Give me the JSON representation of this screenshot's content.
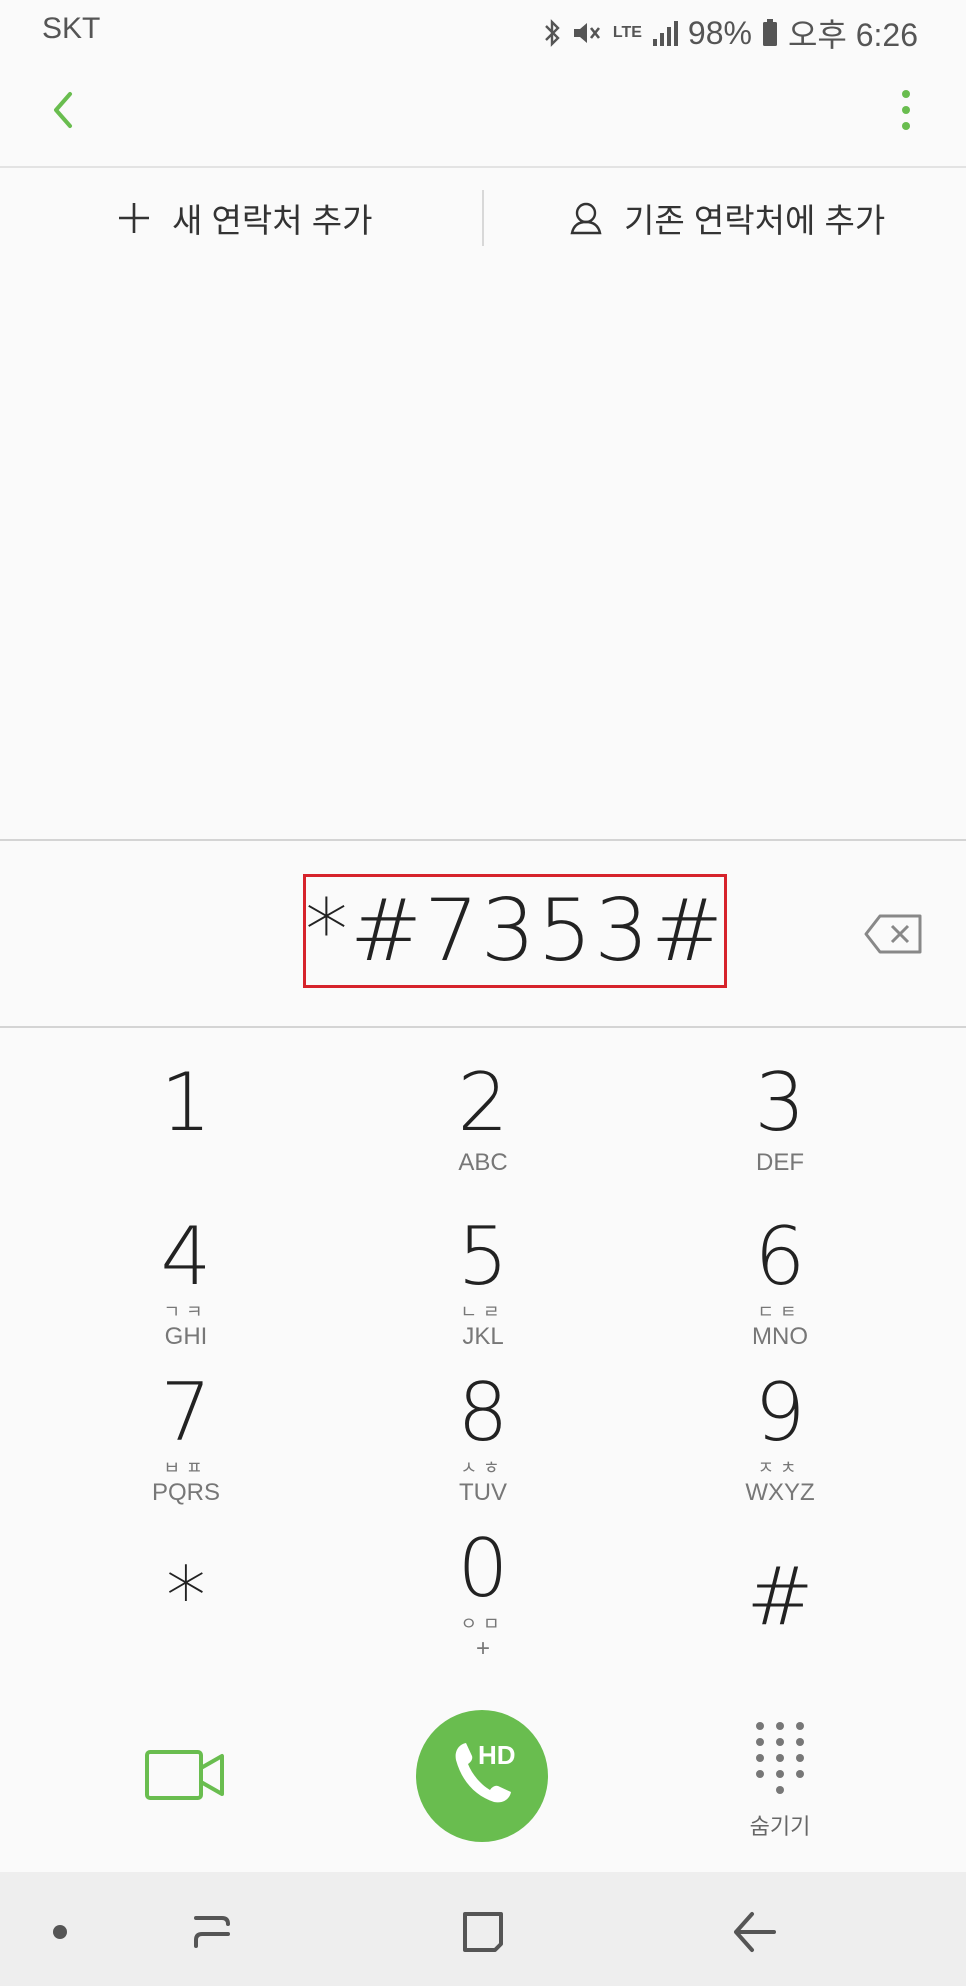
{
  "status_bar": {
    "carrier": "SKT",
    "network": "LTE",
    "battery": "98%",
    "time": "오후 6:26"
  },
  "actions": {
    "new_contact": "새 연락처 추가",
    "add_existing": "기존 연락처에 추가"
  },
  "dialer": {
    "number": "*#7353#"
  },
  "keys": [
    {
      "digit": "1",
      "ko": "",
      "letters": ""
    },
    {
      "digit": "2",
      "ko": "",
      "letters": "ABC"
    },
    {
      "digit": "3",
      "ko": "",
      "letters": "DEF"
    },
    {
      "digit": "4",
      "ko": "ㄱㅋ",
      "letters": "GHI"
    },
    {
      "digit": "5",
      "ko": "ㄴㄹ",
      "letters": "JKL"
    },
    {
      "digit": "6",
      "ko": "ㄷㅌ",
      "letters": "MNO"
    },
    {
      "digit": "7",
      "ko": "ㅂㅍ",
      "letters": "PQRS"
    },
    {
      "digit": "8",
      "ko": "ㅅㅎ",
      "letters": "TUV"
    },
    {
      "digit": "9",
      "ko": "ㅈㅊ",
      "letters": "WXYZ"
    },
    {
      "digit": "*",
      "ko": "",
      "letters": ""
    },
    {
      "digit": "0",
      "ko": "ㅇㅁ",
      "letters": "+"
    },
    {
      "digit": "#",
      "ko": "",
      "letters": ""
    }
  ],
  "bottom": {
    "call_badge": "HD",
    "hide_label": "숨기기"
  },
  "colors": {
    "accent": "#69bd4f",
    "highlight_border": "#d6232b"
  },
  "icons": [
    "back-icon",
    "more-vert-icon",
    "plus-icon",
    "person-icon",
    "backspace-icon",
    "video-call-icon",
    "phone-icon",
    "keypad-icon",
    "nav-dot-icon",
    "recent-apps-icon",
    "home-icon",
    "nav-back-icon"
  ]
}
